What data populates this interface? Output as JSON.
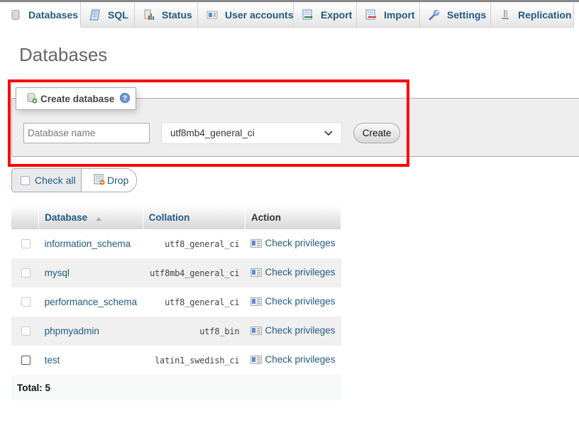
{
  "tabs": [
    {
      "label": "Databases",
      "icon": "database-icon",
      "active": true
    },
    {
      "label": "SQL",
      "icon": "sql-scroll-icon",
      "active": false
    },
    {
      "label": "Status",
      "icon": "status-chart-icon",
      "active": false
    },
    {
      "label": "User accounts",
      "icon": "user-card-icon",
      "active": false
    },
    {
      "label": "Export",
      "icon": "export-icon",
      "active": false
    },
    {
      "label": "Import",
      "icon": "import-icon",
      "active": false
    },
    {
      "label": "Settings",
      "icon": "wrench-icon",
      "active": false
    },
    {
      "label": "Replication",
      "icon": "replication-icon",
      "active": false
    }
  ],
  "page": {
    "title": "Databases"
  },
  "create_database": {
    "legend": "Create database",
    "name_placeholder": "Database name",
    "name_value": "",
    "collation_selected": "utf8mb4_general_ci",
    "create_label": "Create",
    "highlight_color": "#ff0000"
  },
  "bulk_actions": {
    "check_all_label": "Check all",
    "drop_label": "Drop"
  },
  "table": {
    "headers": {
      "database": "Database",
      "collation": "Collation",
      "action": "Action"
    },
    "sort_indicator": "ascending",
    "rows": [
      {
        "name": "information_schema",
        "collation": "utf8_general_ci",
        "action": "Check privileges",
        "selectable": false
      },
      {
        "name": "mysql",
        "collation": "utf8mb4_general_ci",
        "action": "Check privileges",
        "selectable": false
      },
      {
        "name": "performance_schema",
        "collation": "utf8_general_ci",
        "action": "Check privileges",
        "selectable": false
      },
      {
        "name": "phpmyadmin",
        "collation": "utf8_bin",
        "action": "Check privileges",
        "selectable": false
      },
      {
        "name": "test",
        "collation": "latin1_swedish_ci",
        "action": "Check privileges",
        "selectable": true
      }
    ],
    "total_label": "Total: 5"
  },
  "colors": {
    "link": "#235a81",
    "highlight": "#ff0000"
  }
}
